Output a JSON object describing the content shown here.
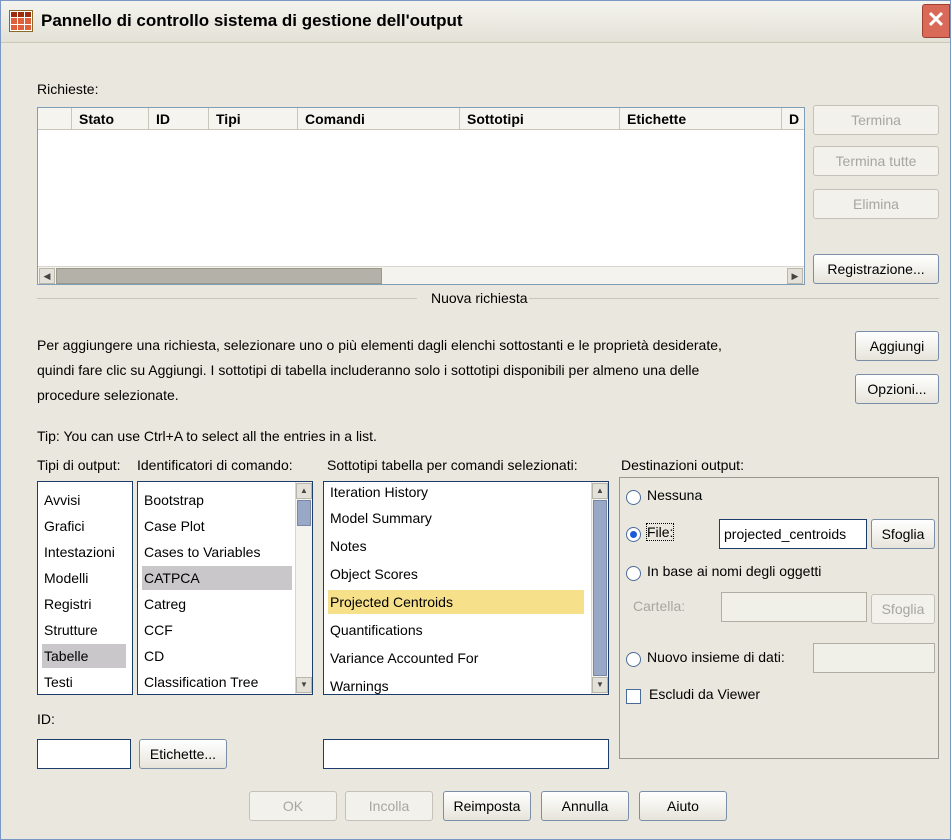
{
  "window": {
    "title": "Pannello di controllo sistema di gestione dell'output",
    "close_glyph": "✕"
  },
  "requests": {
    "label": "Richieste:",
    "columns": [
      "",
      "Stato",
      "ID",
      "Tipi",
      "Comandi",
      "Sottotipi",
      "Etichette",
      "D"
    ],
    "buttons": {
      "terminate": "Termina",
      "terminate_all": "Termina tutte",
      "delete": "Elimina",
      "logging": "Registrazione..."
    }
  },
  "new_request": {
    "heading": "Nuova richiesta",
    "instructions_line1": "Per aggiungere una richiesta, selezionare uno o più elementi dagli elenchi sottostanti e le proprietà desiderate,",
    "instructions_line2": "quindi fare clic su Aggiungi. I sottotipi di tabella includeranno solo i sottotipi disponibili per almeno una delle",
    "instructions_line3": "procedure selezionate.",
    "tip": "Tip: You can use Ctrl+A to select all the entries in a list.",
    "add_button": "Aggiungi",
    "options_button": "Opzioni..."
  },
  "output_types": {
    "label": "Tipi di output:",
    "items": [
      "Avvisi",
      "Grafici",
      "Intestazioni",
      "Modelli",
      "Registri",
      "Strutture",
      "Tabelle",
      "Testi"
    ],
    "selected": "Tabelle"
  },
  "command_ids": {
    "label": "Identificatori di comando:",
    "items": [
      "Bootstrap",
      "Case Plot",
      "Cases to Variables",
      "CATPCA",
      "Catreg",
      "CCF",
      "CD",
      "Classification Tree"
    ],
    "selected": "CATPCA"
  },
  "table_subtypes": {
    "label": "Sottotipi tabella per comandi selezionati:",
    "items": [
      "Iteration History",
      "Model Summary",
      "Notes",
      "Object Scores",
      "Projected Centroids",
      "Quantifications",
      "Variance Accounted For",
      "Warnings"
    ],
    "selected": "Projected Centroids"
  },
  "id_field": {
    "label": "ID:",
    "value": ""
  },
  "labels_button": "Etichette...",
  "subtype_field": {
    "value": ""
  },
  "destinations": {
    "label": "Destinazioni output:",
    "none": "Nessuna",
    "file": "File:",
    "file_value": "projected_centroids",
    "browse": "Sfoglia",
    "by_object_names": "In base ai nomi degli oggetti",
    "folder_label": "Cartella:",
    "folder_value": "",
    "browse2": "Sfoglia",
    "new_dataset": "Nuovo insieme di dati:",
    "new_dataset_value": "",
    "exclude_viewer": "Escludi da Viewer",
    "selected": "File"
  },
  "footer": {
    "ok": "OK",
    "paste": "Incolla",
    "reset": "Reimposta",
    "cancel": "Annulla",
    "help": "Aiuto"
  }
}
